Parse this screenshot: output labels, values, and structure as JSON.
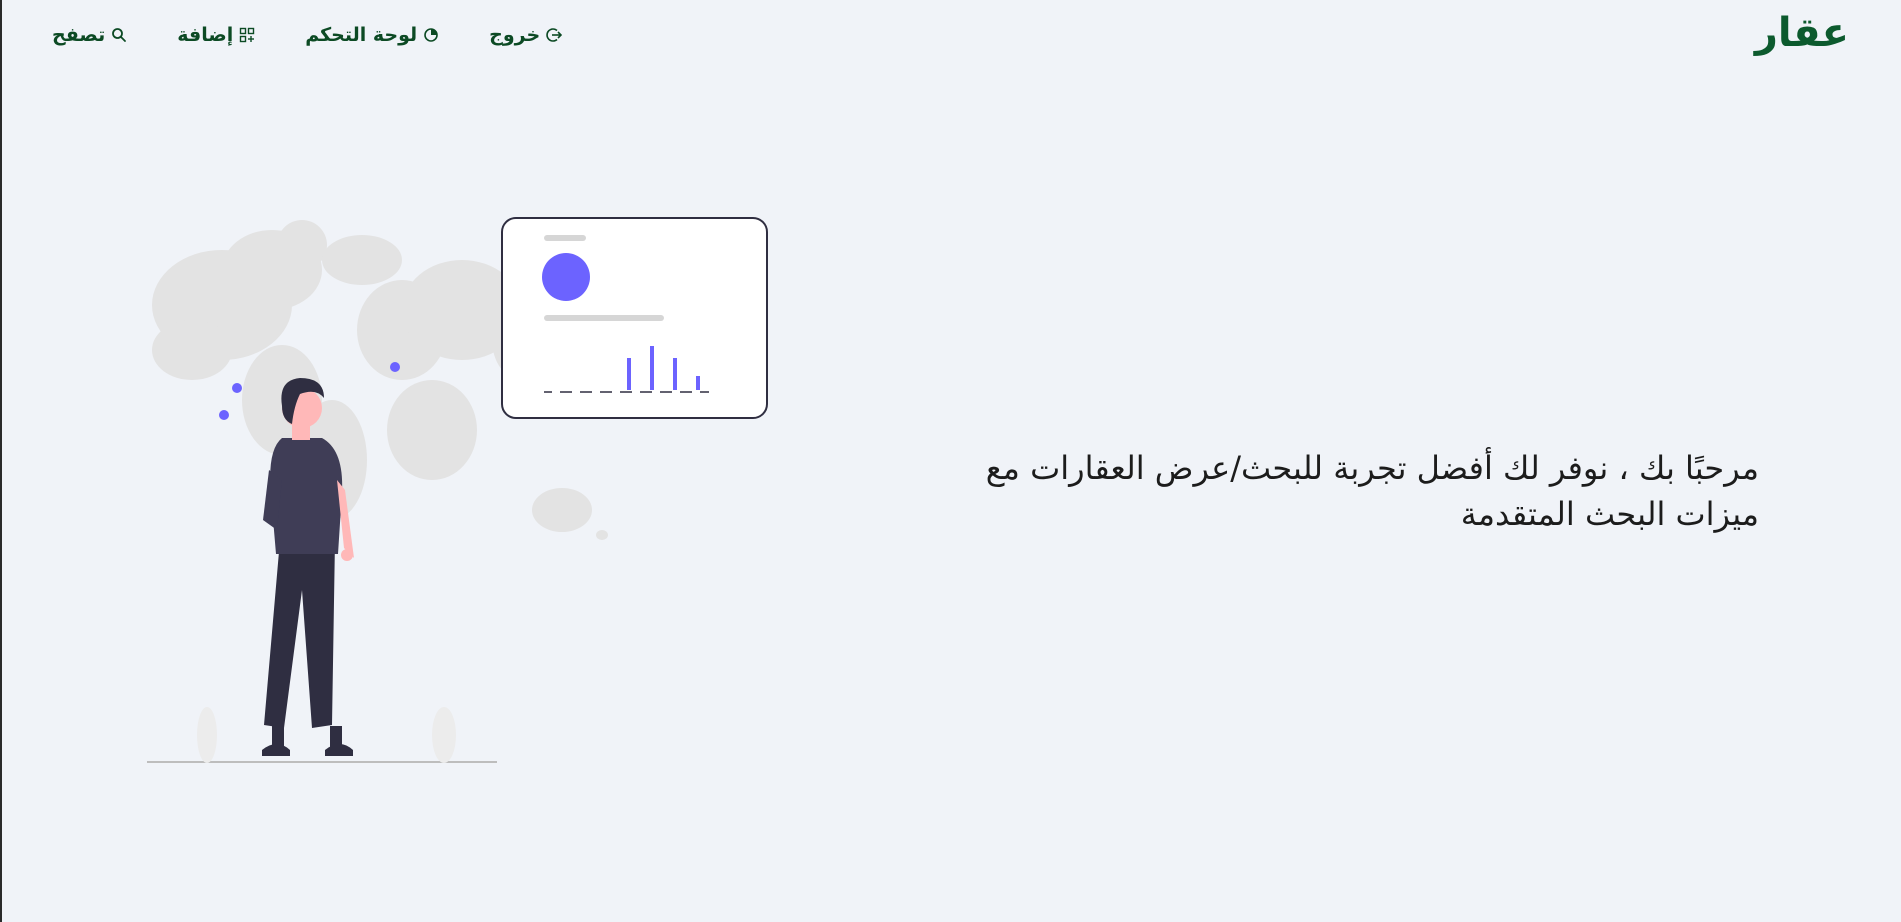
{
  "header": {
    "brand": "عقار",
    "nav": [
      {
        "id": "browse",
        "label": "تصفح",
        "icon": "search-icon"
      },
      {
        "id": "add",
        "label": "إضافة",
        "icon": "add-grid-icon"
      },
      {
        "id": "dashboard",
        "label": "لوحة التحكم",
        "icon": "dashboard-icon"
      },
      {
        "id": "logout",
        "label": "خروج",
        "icon": "logout-icon"
      }
    ]
  },
  "hero": {
    "text": "مرحبًا بك ، نوفر لك أفضل تجربة للبحث/عرض العقارات مع ميزات البحث المتقدمة"
  },
  "colors": {
    "brand": "#0c5a2e",
    "nav_text": "#0c4a24",
    "background": "#f0f3f8",
    "accent": "#6c63ff",
    "figure_dark": "#2f2e41"
  }
}
